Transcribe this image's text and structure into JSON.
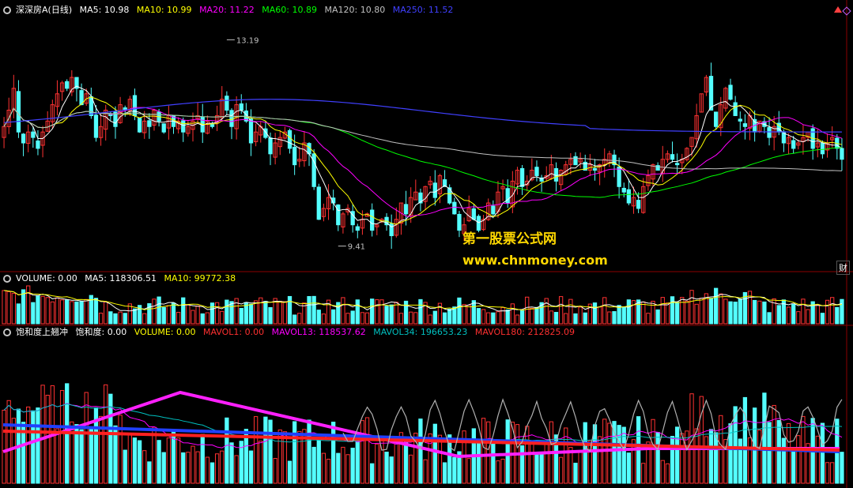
{
  "main_header": {
    "icon": "collapse-icon",
    "stock": "深深房A",
    "period": "(日线)",
    "ma5": "MA5: 10.98",
    "ma10": "MA10: 10.99",
    "ma20": "MA20: 11.22",
    "ma60": "MA60: 10.89",
    "ma120": "MA120: 10.80",
    "ma250": "MA250: 11.52"
  },
  "volume_header": {
    "icon": "collapse-icon",
    "volume": "VOLUME: 0.00",
    "ma5": "MA5: 118306.51",
    "ma10": "MA10: 99772.38"
  },
  "indicator_header": {
    "icon": "collapse-icon",
    "name": "饱和度上翘冲",
    "baohedu": "饱和度: 0.00",
    "volume": "VOLUME: 0.00",
    "mavol1": "MAVOL1: 0.00",
    "mavol13": "MAVOL13: 118537.62",
    "mavol34": "MAVOL34: 196653.23",
    "mavol180": "MAVOL180: 212825.09"
  },
  "watermark": {
    "line1": "第一股票公式网",
    "line2": "www.chnmoney.com"
  },
  "side_label": "财",
  "colors": {
    "ma5": "#ffffff",
    "ma10": "#ffff00",
    "ma20": "#ff00ff",
    "ma60": "#00ff00",
    "ma120": "#c0c0c0",
    "ma250": "#4040ff",
    "up": "#ff3232",
    "down": "#54ffff",
    "label": "#c0c0c0",
    "mavol13": "#ff00ff",
    "mavol34": "#00c0c0",
    "mavol180": "#ff2020"
  },
  "chart_data": {
    "type": "candlestick",
    "y_range": [
      9.0,
      13.6
    ],
    "annotations": [
      {
        "label": "13.19",
        "value": 13.19,
        "index": 46
      },
      {
        "label": "9.41",
        "value": 9.41,
        "index": 69
      }
    ],
    "closes": [
      11.6,
      11.9,
      12.3,
      11.5,
      11.3,
      11.5,
      11.4,
      11.2,
      11.5,
      11.7,
      12.0,
      12.2,
      12.4,
      12.3,
      12.5,
      12.3,
      12.0,
      12.2,
      11.8,
      11.4,
      11.6,
      11.9,
      11.8,
      11.6,
      12.0,
      11.9,
      12.1,
      11.8,
      11.5,
      11.7,
      11.6,
      11.9,
      11.7,
      11.5,
      11.8,
      11.6,
      11.7,
      11.5,
      11.6,
      11.7,
      11.8,
      11.5,
      11.7,
      11.6,
      11.8,
      12.1,
      11.9,
      11.6,
      12.0,
      11.9,
      11.7,
      11.3,
      11.5,
      11.6,
      11.4,
      11.1,
      11.3,
      11.4,
      11.5,
      11.2,
      10.9,
      11.0,
      11.3,
      11.1,
      10.5,
      9.9,
      10.1,
      10.3,
      10.2,
      9.8,
      10.0,
      10.1,
      9.8,
      9.7,
      9.9,
      10.0,
      9.7,
      9.8,
      9.9,
      9.8,
      9.6,
      9.9,
      10.2,
      10.0,
      10.3,
      10.4,
      10.2,
      10.5,
      10.6,
      10.3,
      10.7,
      10.5,
      10.2,
      10.0,
      9.7,
      9.8,
      10.1,
      9.9,
      9.7,
      9.9,
      10.2,
      10.0,
      10.4,
      10.5,
      10.2,
      10.6,
      10.8,
      10.5,
      10.6,
      10.8,
      10.7,
      10.6,
      10.7,
      10.9,
      10.6,
      10.8,
      10.9,
      11.0,
      10.9,
      11.0,
      10.8,
      10.9,
      10.8,
      10.9,
      11.0,
      11.1,
      10.9,
      10.5,
      10.4,
      10.2,
      10.3,
      10.1,
      10.5,
      10.7,
      10.9,
      10.8,
      11.0,
      11.1,
      11.0,
      10.9,
      11.0,
      11.2,
      11.4,
      11.8,
      12.2,
      12.5,
      11.9,
      11.6,
      12.0,
      12.3,
      12.1,
      11.8,
      11.7,
      11.6,
      11.8,
      11.5,
      11.7,
      11.6,
      11.4,
      11.6,
      11.5,
      11.3,
      11.4,
      11.2,
      11.3,
      11.4,
      11.5,
      11.2,
      11.3,
      11.1,
      11.3,
      11.4,
      11.2,
      11.0
    ]
  }
}
